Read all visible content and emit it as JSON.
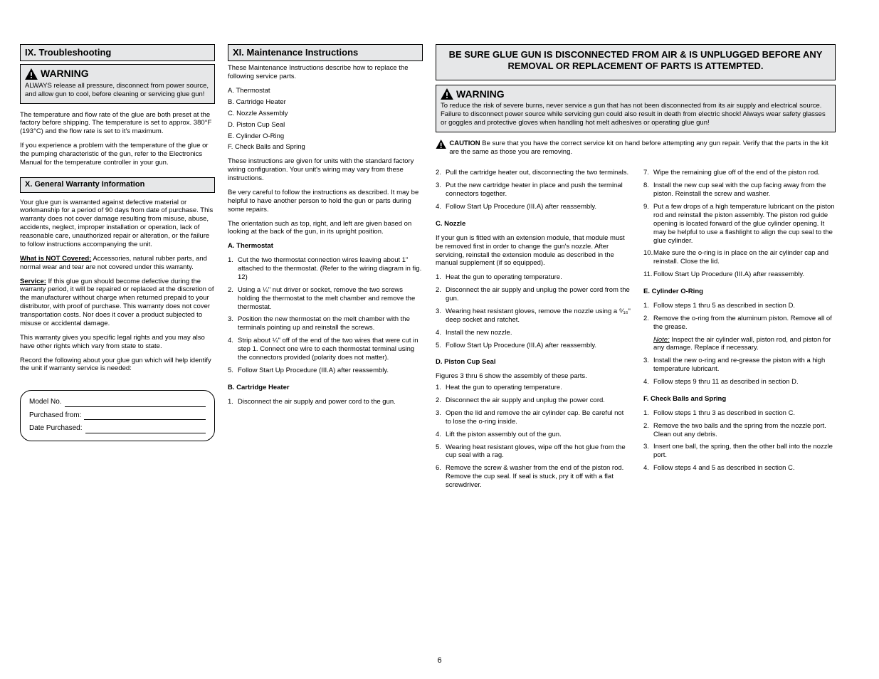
{
  "col1": {
    "header": "IX. Troubleshooting",
    "warn_head": "WARNING",
    "warn_body": "ALWAYS release all pressure, disconnect from power source, and allow gun to cool, before cleaning or servicing glue gun!",
    "para1": "The temperature and flow rate of the glue are both preset at the factory before shipping. The temperature is set to approx. 380°F (193°C) and the flow rate is set to it's maximum.",
    "para2": "If you experience a problem with the temperature of the glue or the pumping characteristic of the gun, refer to the Electronics Manual for the temperature controller in your gun.",
    "sub_header": "X. General Warranty Information",
    "para3": "Your glue gun is warranted against defective material or workmanship for a period of 90 days from date of purchase. This warranty does not cover damage resulting from misuse, abuse, accidents, neglect, improper installation or operation, lack of reasonable care, unauthorized repair or alteration, or the failure to follow instructions accompanying the unit.",
    "para4_label": "What is NOT Covered:",
    "para4_body": " Accessories, natural rubber parts, and normal wear and tear are not covered under this warranty.",
    "para5_label": "Service:",
    "para5_body": " If this glue gun should become defective during the warranty period, it will be repaired or replaced at the discretion of the manufacturer without charge when returned prepaid to your distributor, with proof of purchase. This warranty does not cover transportation costs. Nor does it cover a product subjected to misuse or accidental damage.",
    "para6": "This warranty gives you specific legal rights and you may also have other rights which vary from state to state.",
    "para7": "Record the following about your glue gun which will help identify the unit if warranty service is needed:",
    "record": {
      "model_label": "Model No.",
      "purchased_label": "Purchased from:",
      "date_label": "Date Purchased:"
    }
  },
  "col2": {
    "header": "XI. Maintenance Instructions",
    "para1": "These Maintenance Instructions describe how to replace the following service parts.",
    "items": [
      "A. Thermostat",
      "B. Cartridge Heater",
      "C. Nozzle Assembly",
      "D. Piston Cup Seal",
      "E. Cylinder O-Ring",
      "F. Check Balls and Spring"
    ],
    "para2": "These instructions are given for units with the standard factory wiring configuration. Your unit's wiring may vary from these instructions.",
    "para3": "Be very careful to follow the instructions as described. It may be helpful to have another person to hold the gun or parts during some repairs.",
    "para4": "The orientation such as top, right, and left are given based on looking at the back of the gun, in its upright position.",
    "part_a_title": "A. Thermostat",
    "a_steps": [
      "Cut the two thermostat connection wires leaving about 1\" attached to the thermostat. (Refer to the wiring diagram in fig. 12)",
      "Using a ¼\" nut driver or socket, remove the two screws holding the thermostat to the melt chamber and remove the thermostat.",
      "Position the new thermostat on the melt chamber with the terminals pointing up and reinstall the screws.",
      "Strip about ¼\" off of the end of the two wires that were cut in step 1. Connect one wire to each thermostat terminal using the connectors provided (polarity does not matter).",
      "Follow Start Up Procedure (III.A) after reassembly."
    ],
    "part_b_title": "B. Cartridge Heater",
    "b_steps_first": [
      "Disconnect the air supply and power cord to the gun."
    ]
  },
  "col34": {
    "banner_line1": "BE SURE GLUE GUN IS DISCONNECTED FROM AIR & IS UNPLUGGED BEFORE ANY",
    "banner_line2": "REMOVAL OR REPLACEMENT OF PARTS IS ATTEMPTED.",
    "warn_head": "WARNING",
    "warn_body": "To reduce the risk of severe burns, never service a gun that has not been disconnected from its air supply and electrical source. Failure to disconnect power source while servicing gun could also result in death from electric shock! Always wear safety glasses or goggles and protective gloves when handling hot melt adhesives or operating glue gun!",
    "caution_head": "CAUTION",
    "caution_body": " Be sure that you have the correct service kit on hand before attempting any gun repair. Verify that the parts in the kit are the same as those you are removing."
  },
  "col3": {
    "b_steps": [
      {
        "n": "2.",
        "t": "Pull the cartridge heater out, disconnecting the two terminals."
      },
      {
        "n": "3.",
        "t": "Put the new cartridge heater in place and push the terminal connectors together."
      },
      {
        "n": "4.",
        "t": "Follow Start Up Procedure (III.A) after reassembly."
      }
    ],
    "part_c_title": "C. Nozzle",
    "c_intro": "If your gun is fitted with an extension module, that module must be removed first in order to change the gun's nozzle. After servicing, reinstall the extension module as described in the manual supplement (if so equipped).",
    "c_steps": [
      {
        "n": "1.",
        "t": "Heat the gun to operating temperature."
      },
      {
        "n": "2.",
        "t": "Disconnect the air supply and unplug the power cord from the gun."
      },
      {
        "n": "3.",
        "t": "Wearing heat resistant gloves, remove the nozzle using a ⁹⁄₁₆\" deep socket and ratchet."
      },
      {
        "n": "4.",
        "t": "Install the new nozzle."
      },
      {
        "n": "5.",
        "t": "Follow Start Up Procedure (III.A) after reassembly."
      }
    ],
    "part_d_title": "D. Piston Cup Seal",
    "d_intro": "Figures 3 thru 6 show the assembly of these parts.",
    "d_steps": [
      {
        "n": "1.",
        "t": "Heat the gun to operating temperature."
      },
      {
        "n": "2.",
        "t": "Disconnect the air supply and unplug the power cord."
      },
      {
        "n": "3.",
        "t": "Open the lid and remove the air cylinder cap. Be careful not to lose the o-ring inside."
      },
      {
        "n": "4.",
        "t": "Lift the piston assembly out of the gun."
      },
      {
        "n": "5.",
        "t": "Wearing heat resistant gloves, wipe off the hot glue from the cup seal with a rag."
      },
      {
        "n": "6.",
        "t": "Remove the screw & washer from the end of the piston rod. Remove the cup seal. If seal is stuck, pry it off with a flat screwdriver."
      }
    ]
  },
  "col4": {
    "d_steps": [
      {
        "n": "7.",
        "t": "Wipe the remaining glue off of the end of the piston rod."
      },
      {
        "n": "8.",
        "t": "Install the new cup seal with the cup facing away from the piston. Reinstall the screw and washer."
      },
      {
        "n": "9.",
        "t": "Put a few drops of a high temperature lubricant on the piston rod and reinstall the piston assembly. The piston rod guide opening is located forward of the glue cylinder opening. It may be helpful to use a flashlight to align the cup seal to the glue cylinder."
      },
      {
        "n": "10.",
        "t": "Make sure the o-ring is in place on the air cylinder cap and reinstall. Close the lid."
      },
      {
        "n": "11.",
        "t": "Follow Start Up Procedure (III.A) after reassembly."
      }
    ],
    "part_e_title": "E. Cylinder O-Ring",
    "e_steps": [
      {
        "n": "1.",
        "t": "Follow steps 1 thru 5 as described in section D."
      },
      {
        "n": "2.",
        "t": "Remove the o-ring from the aluminum piston. Remove all of the grease."
      },
      {
        "n": "",
        "t_italic": "Note:",
        "t": " Inspect the air cylinder wall, piston rod, and piston for any damage. Replace if necessary."
      },
      {
        "n": "3.",
        "t": "Install the new o-ring and re-grease the piston with a high temperature lubricant."
      },
      {
        "n": "4.",
        "t": "Follow steps 9 thru 11 as described in section D."
      }
    ],
    "part_f_title": "F. Check Balls and Spring",
    "f_steps": [
      {
        "n": "1.",
        "t": "Follow steps 1 thru 3 as described in section C."
      },
      {
        "n": "2.",
        "t": "Remove the two balls and the spring from the nozzle port. Clean out any debris."
      },
      {
        "n": "3.",
        "t": "Insert one ball, the spring, then the other ball into the nozzle port."
      },
      {
        "n": "4.",
        "t": "Follow steps 4 and 5 as described in section C."
      }
    ]
  },
  "page_number": "6"
}
